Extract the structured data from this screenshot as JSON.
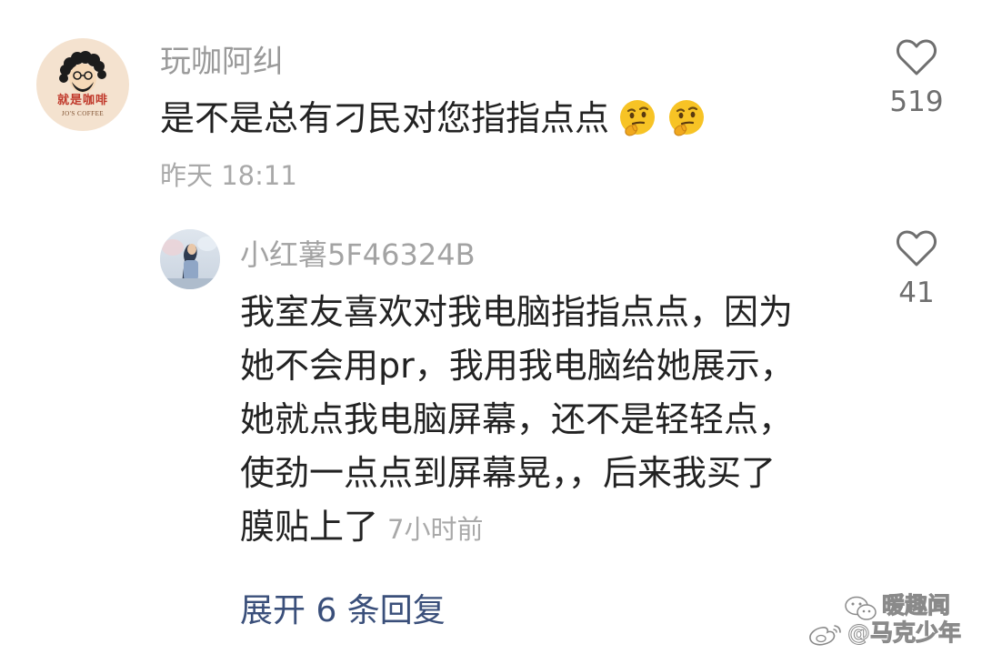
{
  "comment": {
    "username": "玩咖阿纠",
    "avatar_brand": "就是咖啡",
    "avatar_sub": "JO'S COFFEE",
    "text": "是不是总有刁民对您指指点点",
    "emojis": [
      "thinking-face-emoji",
      "thinking-face-emoji"
    ],
    "time": "昨天 18:11",
    "like_count": "519"
  },
  "reply": {
    "username": "小红薯5F46324B",
    "lines": [
      "我室友喜欢对我电脑指指点点，因为",
      "她不会用pr，我用我电脑给她展示，",
      "她就点我电脑屏幕，还不是轻轻点，",
      "使劲一点点到屏幕晃，，后来我买了",
      "膜贴上了"
    ],
    "time": "7小时前",
    "like_count": "41",
    "expand_label": "展开 6 条回复"
  },
  "watermark": {
    "top": "暖趣闻",
    "bottom": "@马克少年"
  },
  "colors": {
    "text_primary": "#222222",
    "text_secondary": "#9a9a9a",
    "link_blue": "#3a4f7a",
    "like_icon": "#6f6f6f"
  },
  "icons": {
    "like": "heart-outline-icon",
    "watermark_left": "wechat-icon",
    "watermark_right": "weibo-icon"
  }
}
